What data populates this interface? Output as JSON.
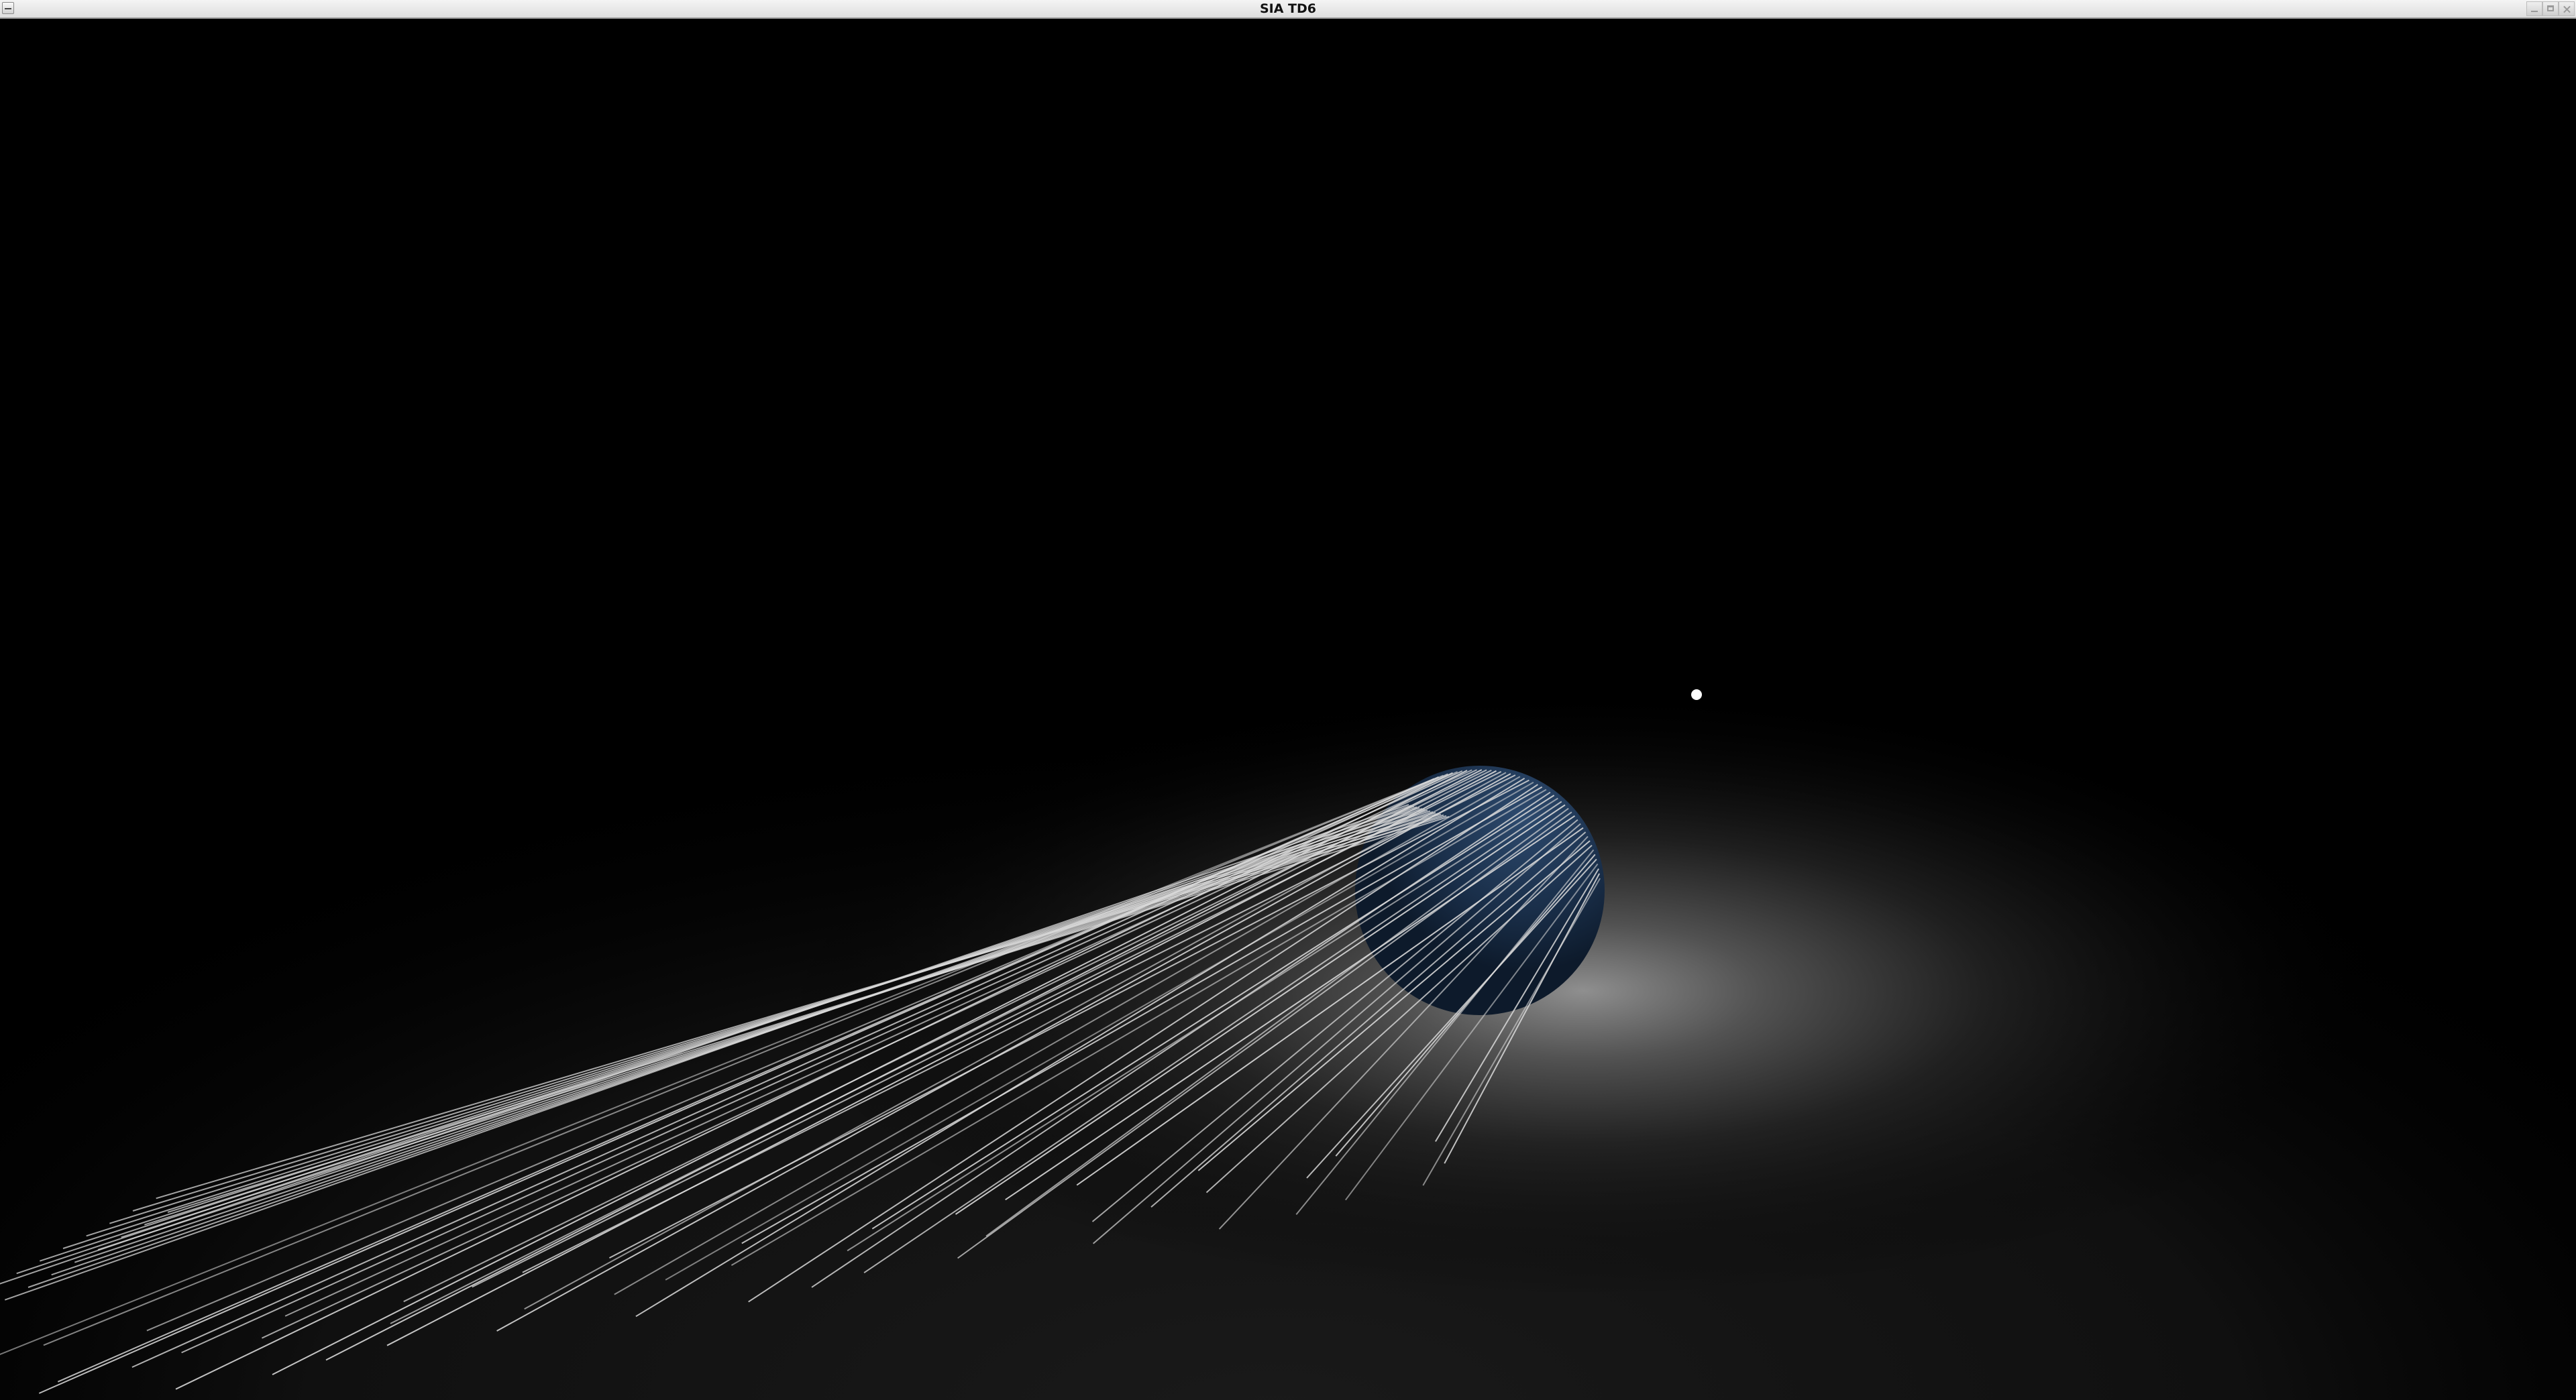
{
  "window": {
    "title": "SIA TD6"
  },
  "scene": {
    "background": "#000000",
    "ground_glow_color": "#8a8a8a",
    "sphere_color": "#1e3552",
    "light_color": "#ffffff",
    "ray_color": "#d8d8d8",
    "icons": {
      "window_menu": "window-menu-icon",
      "minimize": "minimize-icon",
      "maximize": "maximize-icon",
      "close": "close-icon"
    }
  }
}
